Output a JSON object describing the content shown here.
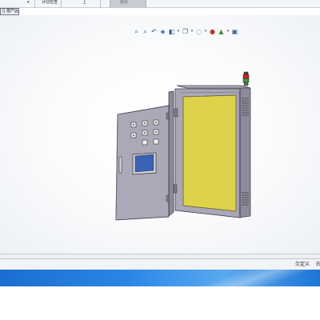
{
  "toolbar": {
    "fragment_1": "·",
    "fragment_2": "▾",
    "fragment_3": "评估检查",
    "fragment_4": "上",
    "fragment_5": "面板",
    "feature_tab_label": "|| 基产品"
  },
  "hud_icons": [
    "zoom-to-fit-icon",
    "zoom-area-icon",
    "previous-view-icon",
    "section-view-icon",
    "view-orientation-icon",
    "display-style-icon",
    "hide-show-items-icon",
    "edit-appearance-icon",
    "apply-scene-icon",
    "view-settings-icon"
  ],
  "model": {
    "description_colors": {
      "cabinet_body": "#a9a6b6",
      "door_panel": "#aba8b8",
      "mounting_plate": "#ded24a",
      "screen": "#3a63b5",
      "signal_lamp_red": "#d42020",
      "signal_lamp_green": "#3c9a3c"
    }
  },
  "status": {
    "text_1": "欠定义",
    "text_2": "石"
  },
  "colors": {
    "taskbar": "#2a86e6",
    "background": "#ffffff"
  }
}
